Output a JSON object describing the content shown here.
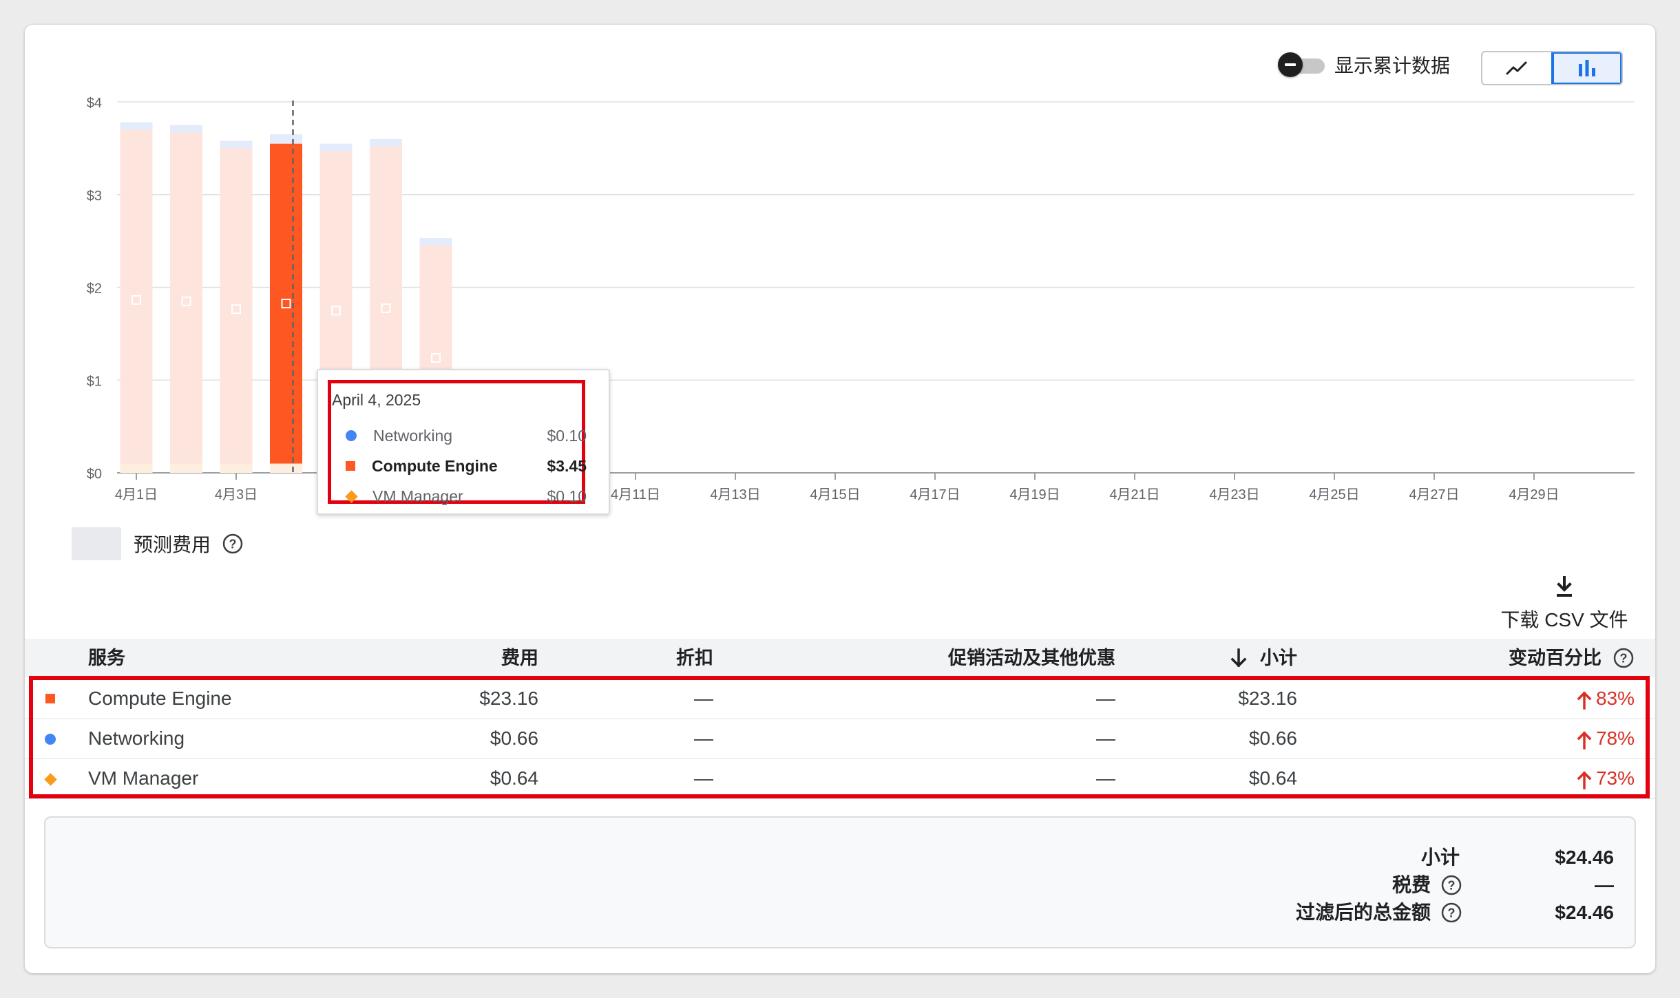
{
  "controls": {
    "cumulative_label": "显示累计数据",
    "cumulative_on": false,
    "view_options": [
      {
        "icon": "line-chart-icon",
        "active": false
      },
      {
        "icon": "bar-chart-icon",
        "active": true
      }
    ]
  },
  "legend": {
    "forecast_label": "预测费用",
    "help_icon": "help-circle-icon"
  },
  "colors": {
    "compute_engine": "#ff5722",
    "compute_engine_faded": "#fde4dd",
    "networking": "#4285f4",
    "networking_faded": "#e4ebfb",
    "vm_manager": "#fb9b1a",
    "vm_manager_faded": "#fdeedd",
    "increase": "#d93025",
    "highlight": "#e3000f"
  },
  "chart_data": {
    "type": "bar",
    "stacked": true,
    "y_ticks": [
      "$0",
      "$1",
      "$2",
      "$3",
      "$4"
    ],
    "ylim": [
      0,
      4
    ],
    "x_tick_labels": [
      "4月1日",
      "4月3日",
      "4月11日",
      "4月13日",
      "4月15日",
      "4月17日",
      "4月19日",
      "4月21日",
      "4月23日",
      "4月25日",
      "4月27日",
      "4月29日"
    ],
    "x_tick_days": [
      1,
      3,
      11,
      13,
      15,
      17,
      19,
      21,
      23,
      25,
      27,
      29
    ],
    "days_in_month": 30,
    "highlighted_day": 4,
    "bars": [
      {
        "day": 1,
        "vm_manager": 0.1,
        "compute_engine": 3.6,
        "networking": 0.08
      },
      {
        "day": 2,
        "vm_manager": 0.1,
        "compute_engine": 3.57,
        "networking": 0.08
      },
      {
        "day": 3,
        "vm_manager": 0.1,
        "compute_engine": 3.4,
        "networking": 0.08
      },
      {
        "day": 4,
        "vm_manager": 0.1,
        "compute_engine": 3.45,
        "networking": 0.1
      },
      {
        "day": 5,
        "vm_manager": 0.1,
        "compute_engine": 3.37,
        "networking": 0.08
      },
      {
        "day": 6,
        "vm_manager": 0.1,
        "compute_engine": 3.42,
        "networking": 0.08
      },
      {
        "day": 7,
        "vm_manager": 0.09,
        "compute_engine": 2.36,
        "networking": 0.08
      }
    ],
    "tooltip": {
      "date": "April 4, 2025",
      "rows": [
        {
          "name": "Networking",
          "value": "$0.10",
          "marker": "circle"
        },
        {
          "name": "Compute Engine",
          "value": "$3.45",
          "marker": "square"
        },
        {
          "name": "VM Manager",
          "value": "$0.10",
          "marker": "diamond"
        }
      ]
    }
  },
  "download": {
    "label": "下载 CSV 文件",
    "icon": "download-icon"
  },
  "table": {
    "headers": {
      "service": "服务",
      "cost": "费用",
      "discount": "折扣",
      "promotions": "促销活动及其他优惠",
      "subtotal": "小计",
      "change": "变动百分比"
    },
    "rows": [
      {
        "service": "Compute Engine",
        "marker": "square",
        "cost": "$23.16",
        "discount": "—",
        "promotions": "—",
        "subtotal": "$23.16",
        "change": "83%"
      },
      {
        "service": "Networking",
        "marker": "circle",
        "cost": "$0.66",
        "discount": "—",
        "promotions": "—",
        "subtotal": "$0.66",
        "change": "78%"
      },
      {
        "service": "VM Manager",
        "marker": "diamond",
        "cost": "$0.64",
        "discount": "—",
        "promotions": "—",
        "subtotal": "$0.64",
        "change": "73%"
      }
    ]
  },
  "totals": {
    "subtotal_label": "小计",
    "subtotal_value": "$24.46",
    "tax_label": "税费",
    "tax_value": "—",
    "filtered_total_label": "过滤后的总金额",
    "filtered_total_value": "$24.46"
  }
}
